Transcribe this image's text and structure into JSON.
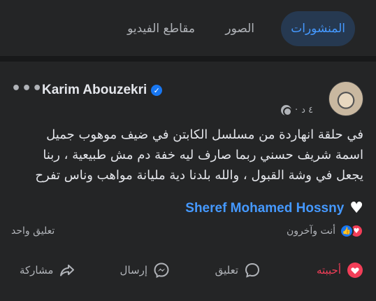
{
  "tabs": {
    "posts": "المنشورات",
    "photos": "الصور",
    "videos": "مقاطع الفيديو"
  },
  "post": {
    "author": "Karim Abouzekri",
    "time": "٤ د",
    "dot": "·",
    "more": "•••",
    "lines": [
      "في حلقة انهاردة من مسلسل الكابتن في ضيف موهوب جميل",
      "اسمة شريف حسني ربما صارف ليه خفة دم مش طبيعية ، ربنا",
      "يجعل في وشة القبول ، والله بلدنا دية مليانة مواهب وناس تفرح"
    ],
    "mention": "Sheref Mohamed Hossny",
    "reactions_text": "أنت وآخرون",
    "comments_count": "تعليق واحد"
  },
  "actions": {
    "like": "أحببته",
    "comment": "تعليق",
    "send": "إرسال",
    "share": "مشاركة"
  },
  "colors": {
    "background": "#242526",
    "accent": "#4599ff",
    "love": "#f33e58"
  }
}
